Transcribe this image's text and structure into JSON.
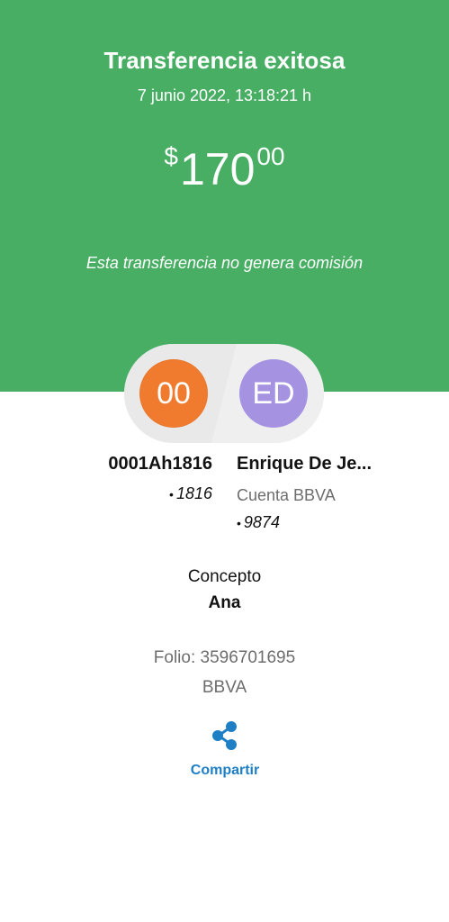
{
  "header": {
    "title": "Transferencia exitosa",
    "datetime": "7 junio 2022, 13:18:21 h",
    "amount": {
      "currency": "$",
      "integer": "170",
      "decimals": "00"
    },
    "commission_note": "Esta transferencia no genera comisión",
    "background_color": "#48ae64"
  },
  "origin": {
    "initials": "00",
    "name": "0001Ah1816",
    "bullet": "•",
    "account": "1816",
    "avatar_color": "#f07b2e"
  },
  "destination": {
    "initials": "ED",
    "name": "Enrique De Je...",
    "bank": "Cuenta BBVA",
    "bullet": "•",
    "account": "9874",
    "avatar_color": "#a593e2"
  },
  "concept": {
    "label": "Concepto",
    "value": "Ana"
  },
  "folio": "Folio: 3596701695",
  "bank": "BBVA",
  "share": {
    "label": "Compartir",
    "icon": "share-icon",
    "color": "#1f7fc5"
  }
}
